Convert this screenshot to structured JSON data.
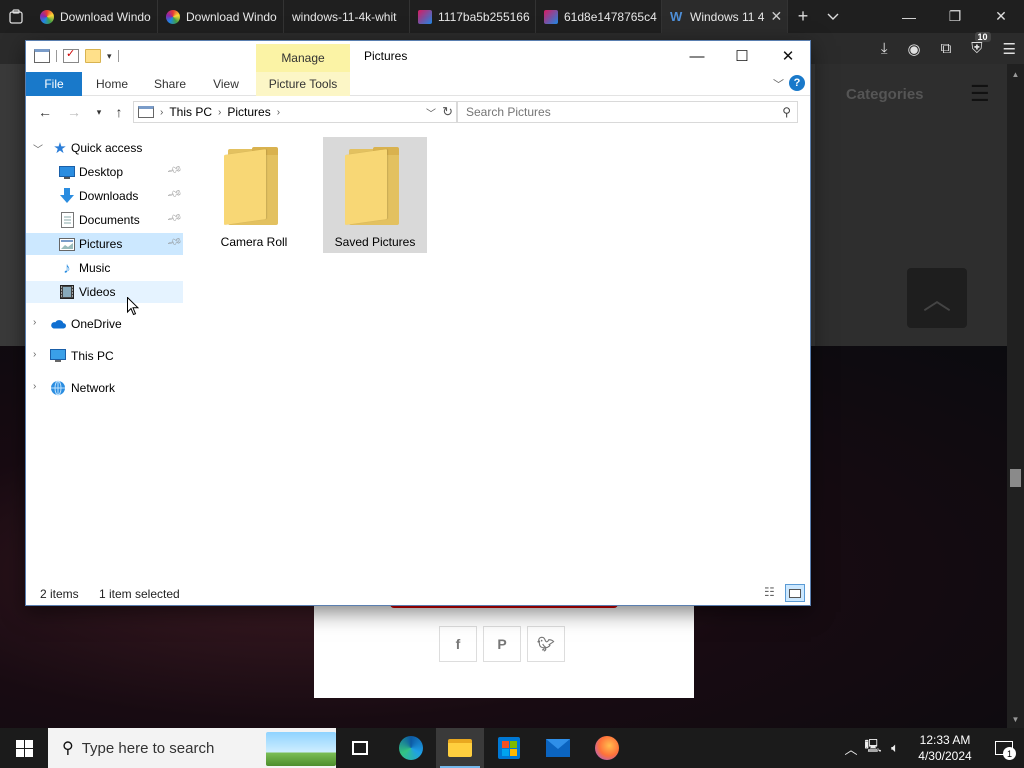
{
  "browser": {
    "tabs": [
      {
        "label": "Download Windo",
        "icon": "colorful-ring-icon"
      },
      {
        "label": "Download Windo",
        "icon": "colorful-ring-icon"
      },
      {
        "label": "windows-11-4k-whit",
        "icon": "none"
      },
      {
        "label": "1117ba5b255166",
        "icon": "image-icon"
      },
      {
        "label": "61d8e1478765c4",
        "icon": "image-icon"
      },
      {
        "label": "Windows 11 4",
        "icon": "w-logo-icon",
        "active": true
      }
    ],
    "new_tab_symbol": "+",
    "extension_badge": "10",
    "webpage": {
      "categories_label": "Categories"
    }
  },
  "explorer": {
    "manage_label": "Manage",
    "title": "Pictures",
    "ribbon_tabs": [
      "File",
      "Home",
      "Share",
      "View",
      "Picture Tools"
    ],
    "help_symbol": "?",
    "breadcrumb": [
      "This PC",
      "Pictures"
    ],
    "search_placeholder": "Search Pictures",
    "nav": {
      "quick_access": "Quick access",
      "quick_items": [
        {
          "label": "Desktop",
          "pinned": true
        },
        {
          "label": "Downloads",
          "pinned": true
        },
        {
          "label": "Documents",
          "pinned": true
        },
        {
          "label": "Pictures",
          "pinned": true,
          "selected": true
        },
        {
          "label": "Music",
          "pinned": false
        },
        {
          "label": "Videos",
          "pinned": false,
          "hover": true
        }
      ],
      "roots": [
        "OneDrive",
        "This PC",
        "Network"
      ]
    },
    "items": [
      {
        "label": "Camera Roll",
        "selected": false
      },
      {
        "label": "Saved Pictures",
        "selected": true
      }
    ],
    "status": {
      "count": "2 items",
      "selection": "1 item selected"
    }
  },
  "taskbar": {
    "search_placeholder": "Type here to search",
    "time": "12:33 AM",
    "date": "4/30/2024",
    "notification_count": "1",
    "colors": {
      "accent": "#76b9ed",
      "taskbar": "#1b1b1b"
    }
  }
}
